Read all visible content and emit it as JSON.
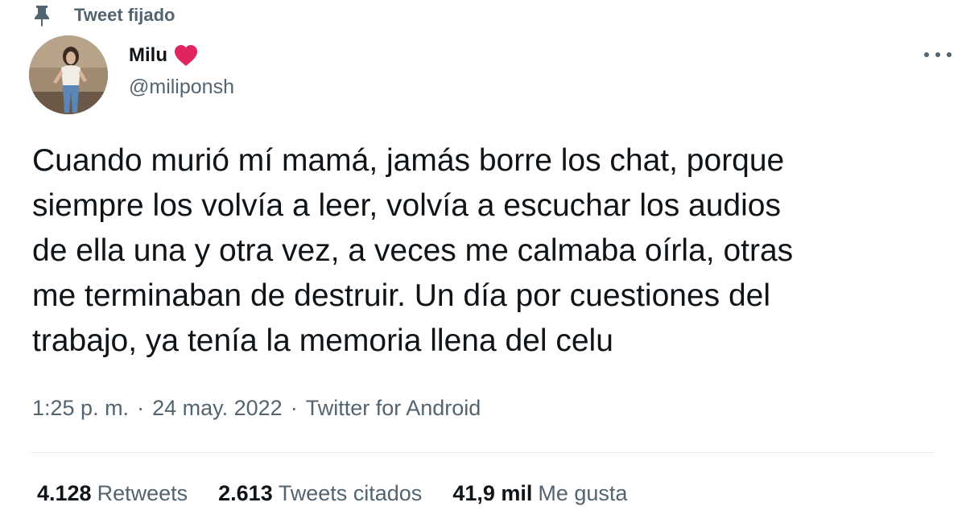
{
  "pinned": {
    "label": "Tweet fijado",
    "icon": "pin-icon"
  },
  "author": {
    "display_name": "Milu",
    "badge_icon": "heart-icon",
    "badge_color": "#e0245e",
    "handle": "@miliponsh",
    "avatar_icon": "avatar"
  },
  "more_icon": "more-icon",
  "tweet": {
    "text": "Cuando murió mí mamá, jamás borre los chat, porque\nsiempre los volvía a leer, volvía a escuchar los audios\nde ella una y otra vez, a veces me calmaba oírla, otras\nme terminaban de destruir. Un día por cuestiones del\ntrabajo, ya tenía la memoria llena del celu"
  },
  "meta": {
    "time": "1:25 p. m.",
    "separator": "·",
    "date": "24 may. 2022",
    "source": "Twitter for Android"
  },
  "stats": {
    "retweets_count": "4.128",
    "retweets_label": "Retweets",
    "quotes_count": "2.613",
    "quotes_label": "Tweets citados",
    "likes_count": "41,9 mil",
    "likes_label": "Me gusta"
  },
  "colors": {
    "text_primary": "#0f1419",
    "text_secondary": "#536471",
    "divider": "#e6ecf0",
    "heart": "#e0245e"
  }
}
